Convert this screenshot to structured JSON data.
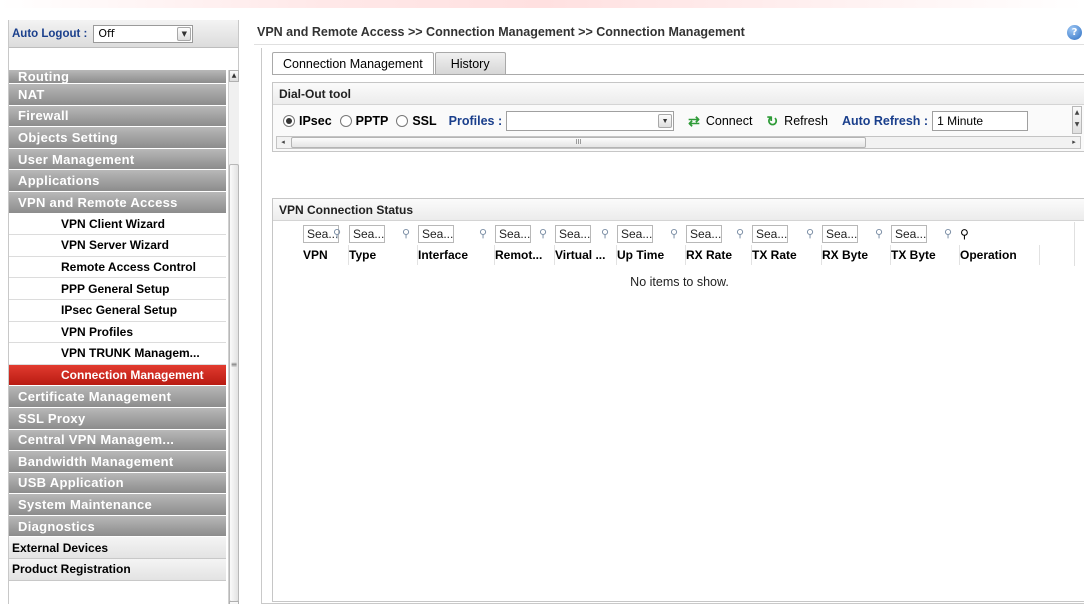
{
  "sidebar": {
    "auto_logout_label": "Auto Logout :",
    "auto_logout_value": "Off",
    "items": [
      {
        "label": "Routing",
        "kind": "grey"
      },
      {
        "label": "NAT",
        "kind": "grey"
      },
      {
        "label": "Firewall",
        "kind": "grey"
      },
      {
        "label": "Objects Setting",
        "kind": "grey"
      },
      {
        "label": "User Management",
        "kind": "grey"
      },
      {
        "label": "Applications",
        "kind": "grey"
      },
      {
        "label": "VPN and Remote Access",
        "kind": "grey"
      },
      {
        "label": "VPN Client Wizard",
        "kind": "sub"
      },
      {
        "label": "VPN Server Wizard",
        "kind": "sub"
      },
      {
        "label": "Remote Access Control",
        "kind": "sub"
      },
      {
        "label": "PPP General Setup",
        "kind": "sub"
      },
      {
        "label": "IPsec General Setup",
        "kind": "sub"
      },
      {
        "label": "VPN Profiles",
        "kind": "sub"
      },
      {
        "label": "VPN TRUNK Managem...",
        "kind": "sub"
      },
      {
        "label": "Connection Management",
        "kind": "active"
      },
      {
        "label": "Certificate Management",
        "kind": "grey"
      },
      {
        "label": "SSL Proxy",
        "kind": "grey"
      },
      {
        "label": "Central VPN Managem...",
        "kind": "grey"
      },
      {
        "label": "Bandwidth Management",
        "kind": "grey"
      },
      {
        "label": "USB Application",
        "kind": "grey"
      },
      {
        "label": "System Maintenance",
        "kind": "grey"
      },
      {
        "label": "Diagnostics",
        "kind": "grey"
      },
      {
        "label": "External Devices",
        "kind": "plain"
      },
      {
        "label": "Product Registration",
        "kind": "plain"
      }
    ]
  },
  "header": {
    "breadcrumb": "VPN and Remote Access >> Connection Management >> Connection Management",
    "help": "?"
  },
  "tabs": [
    "Connection Management",
    "History"
  ],
  "dialout": {
    "title": "Dial-Out tool",
    "radio_ipsec": "IPsec",
    "radio_pptp": "PPTP",
    "radio_ssl": "SSL",
    "selected": "IPsec",
    "profiles_label": "Profiles :",
    "profiles_value": "",
    "connect_label": "Connect",
    "refresh_label": "Refresh",
    "auto_refresh_label": "Auto Refresh :",
    "auto_refresh_value": "1 Minute",
    "scroll_grip": "III"
  },
  "status": {
    "title": "VPN Connection Status",
    "filter_placeholder": "Sea...",
    "columns": [
      "VPN",
      "Type",
      "Interface",
      "Remot...",
      "Virtual ...",
      "Up Time",
      "RX Rate",
      "TX Rate",
      "RX Byte",
      "TX Byte",
      "Operation"
    ],
    "empty_text": "No items to show."
  },
  "colors": {
    "active_item": "#c4231a",
    "label_blue": "#1a3f8c",
    "menu_grey": "#9e9e9e"
  },
  "icons": {
    "connect": "connect-icon",
    "refresh": "refresh-icon",
    "help": "help-icon",
    "filter": "filter-icon"
  }
}
